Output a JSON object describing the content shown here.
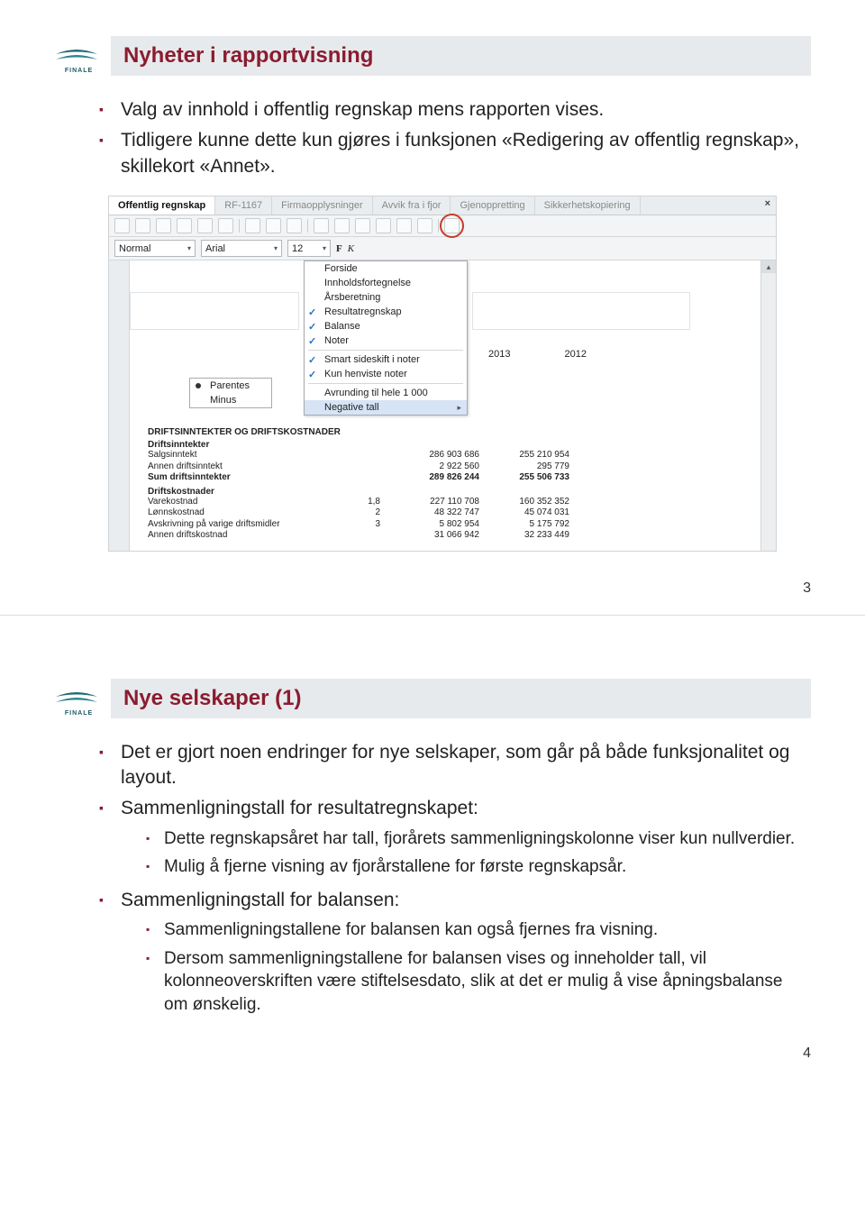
{
  "logo_label": "FINALE",
  "slide1": {
    "title": "Nyheter i rapportvisning",
    "bullets": [
      "Valg av innhold i offentlig regnskap mens rapporten vises.",
      "Tidligere kunne dette kun gjøres i funksjonen «Redigering av offentlig regnskap», skillekort «Annet»."
    ],
    "page_num": "3"
  },
  "screenshot": {
    "tabs": [
      "Offentlig regnskap",
      "RF-1167",
      "Firmaopplysninger",
      "Avvik fra i fjor",
      "Gjenoppretting",
      "Sikkerhetskopiering"
    ],
    "close": "×",
    "format": {
      "style": "Normal",
      "font": "Arial",
      "size": "12",
      "bold": "F",
      "italic": "K"
    },
    "dropdown": {
      "items": [
        {
          "label": "Forside",
          "check": false
        },
        {
          "label": "Innholdsfortegnelse",
          "check": false
        },
        {
          "label": "Årsberetning",
          "check": false
        },
        {
          "label": "Resultatregnskap",
          "check": true
        },
        {
          "label": "Balanse",
          "check": true
        },
        {
          "label": "Noter",
          "check": true
        }
      ],
      "items2": [
        {
          "label": "Smart sideskift i noter",
          "check": true
        },
        {
          "label": "Kun henviste noter",
          "check": true
        }
      ],
      "items3": [
        {
          "label": "Avrunding til hele 1 000",
          "check": false,
          "arrow": false
        },
        {
          "label": "Negative tall",
          "check": false,
          "arrow": true,
          "highlight": true
        }
      ],
      "neg_submenu": [
        "Parentes",
        "Minus"
      ]
    },
    "years": {
      "y1": "2013",
      "y2": "2012"
    },
    "report": {
      "heading": "DRIFTSINNTEKTER OG DRIFTSKOSTNADER",
      "inntekter_header": "Driftsinntekter",
      "rows_inntekter": [
        {
          "label": "Salgsinntekt",
          "note": "",
          "c1": "286 903 686",
          "c2": "255 210 954"
        },
        {
          "label": "Annen driftsinntekt",
          "note": "",
          "c1": "2 922 560",
          "c2": "295 779"
        },
        {
          "label": "Sum driftsinntekter",
          "note": "",
          "c1": "289 826 244",
          "c2": "255 506 733",
          "bold": true
        }
      ],
      "kostnader_header": "Driftskostnader",
      "rows_kostnader": [
        {
          "label": "Varekostnad",
          "note": "1,8",
          "c1": "227 110 708",
          "c2": "160 352 352"
        },
        {
          "label": "Lønnskostnad",
          "note": "2",
          "c1": "48 322 747",
          "c2": "45 074 031"
        },
        {
          "label": "Avskrivning på varige driftsmidler",
          "note": "3",
          "c1": "5 802 954",
          "c2": "5 175 792"
        },
        {
          "label": "Annen driftskostnad",
          "note": "",
          "c1": "31 066 942",
          "c2": "32 233 449"
        }
      ]
    }
  },
  "slide2": {
    "title": "Nye selskaper (1)",
    "b1": "Det er gjort noen endringer for nye selskaper, som går på både funksjonalitet og layout.",
    "b2": "Sammenligningstall for resultatregnskapet:",
    "b2a": "Dette regnskapsåret har tall, fjorårets sammenligningskolonne viser kun nullverdier.",
    "b2b": "Mulig å fjerne visning av fjorårstallene for første regnskapsår.",
    "b3": "Sammenligningstall for balansen:",
    "b3a": "Sammenligningstallene for balansen kan også fjernes fra visning.",
    "b3b": "Dersom sammenligningstallene for balansen vises og inneholder tall, vil kolonneoverskriften være stiftelsesdato, slik at det er mulig å vise åpningsbalanse om ønskelig.",
    "page_num": "4"
  }
}
